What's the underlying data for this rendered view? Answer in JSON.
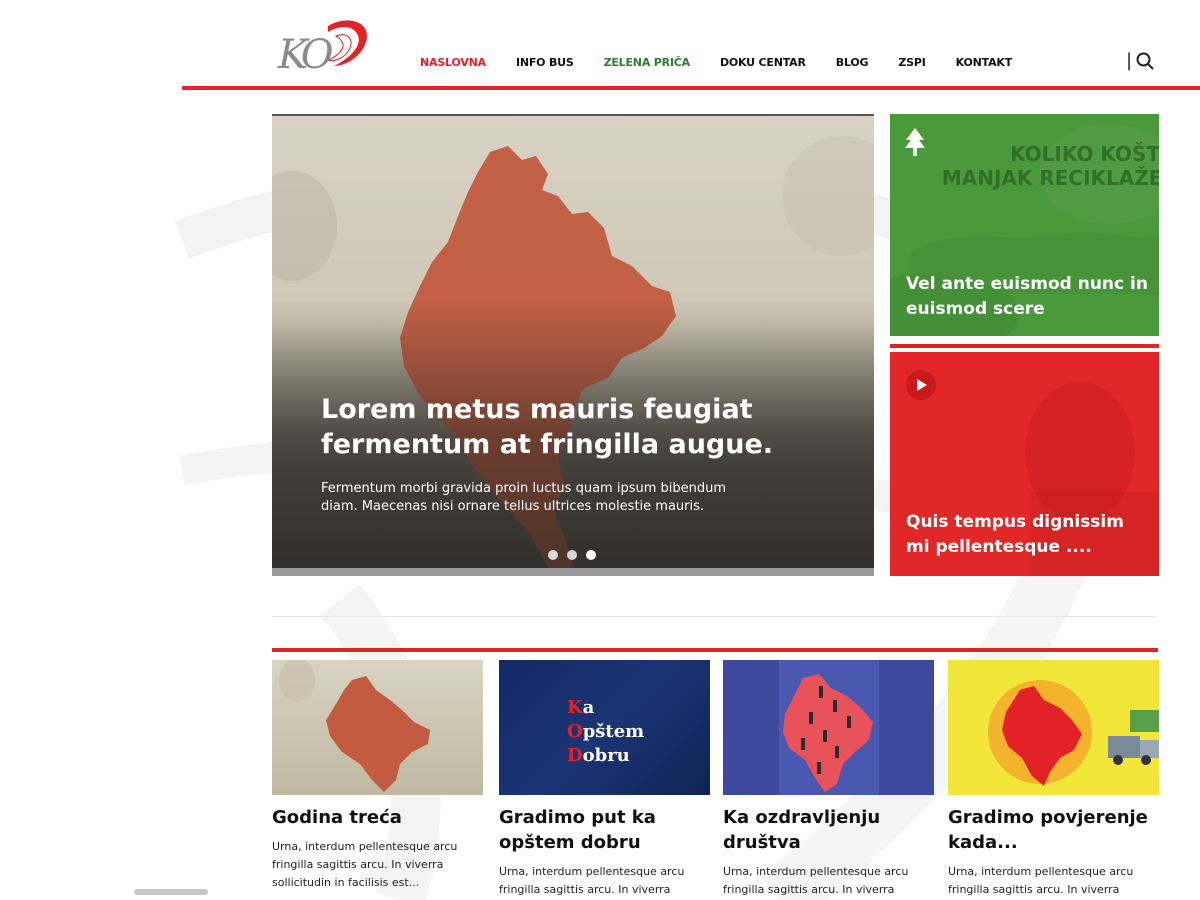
{
  "brand": {
    "logo_text": "KO",
    "accent": "#e32228",
    "green": "#4a9a3c"
  },
  "nav": {
    "items": [
      {
        "label": "NASLOVNA"
      },
      {
        "label": "INFO BUS"
      },
      {
        "label": "ZELENA PRIČA"
      },
      {
        "label": "DOKU CENTAR"
      },
      {
        "label": "BLOG"
      },
      {
        "label": "ZSPI"
      },
      {
        "label": "KONTAKT"
      }
    ],
    "active": "NASLOVNA",
    "search_icon": "search-icon"
  },
  "hero": {
    "title": "Lorem metus mauris feugiat fermentum at fringilla augue.",
    "description": "Fermentum morbi gravida proin luctus quam ipsum bibendum diam. Maecenas nisi ornare tellus ultrices molestie mauris.",
    "slides": 3,
    "active_slide": 3
  },
  "side_cards": [
    {
      "headline_image_text": "KOLIKO KOŠTA MANJAK RECIKLAŽE?",
      "title": "Vel ante euismod nunc in euismod scere",
      "icon": "tree-icon"
    },
    {
      "title": "Quis tempus dignissim mi pellentesque ....",
      "icon": "play-icon"
    }
  ],
  "news": [
    {
      "title": "Godina treća",
      "text": "Urna, interdum pellentesque arcu fringilla sagittis arcu. In viverra sollicitudin in facilisis est..."
    },
    {
      "title": "Gradimo put ka opštem dobru",
      "text": "Urna, interdum pellentesque arcu fringilla sagittis arcu. In viverra",
      "image_text": {
        "l1": "K",
        "l1rest": "a",
        "l2": "O",
        "l2rest": "pštem",
        "l3": "D",
        "l3rest": "obru"
      }
    },
    {
      "title": "Ka ozdravljenju društva",
      "text": "Urna, interdum pellentesque arcu fringilla sagittis arcu. In viverra"
    },
    {
      "title": "Gradimo povjerenje kada...",
      "text": "Urna, interdum pellentesque arcu fringilla sagittis arcu. In viverra"
    }
  ]
}
